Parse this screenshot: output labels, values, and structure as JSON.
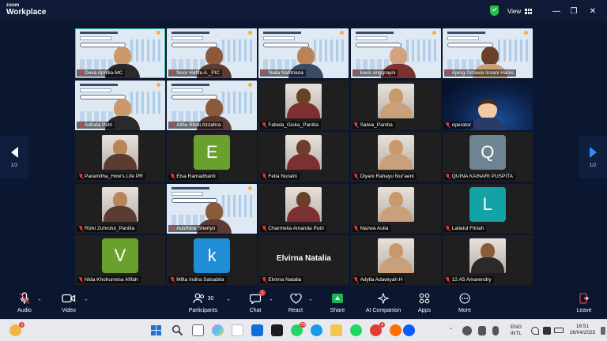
{
  "app": {
    "brand_top": "zoom",
    "brand_bottom": "Workplace",
    "view_label": "View"
  },
  "gallery": {
    "tiles": [
      {
        "name": "Deva Aprillia-MC",
        "kind": "slide",
        "active": true
      },
      {
        "name": "Noor Hafifa A._PIC",
        "kind": "slide"
      },
      {
        "name": "Naila Nafitriana",
        "kind": "slide"
      },
      {
        "name": "luwis anggrayni",
        "kind": "slide"
      },
      {
        "name": "Ajeng Octavia Insani Hanis",
        "kind": "slide"
      },
      {
        "name": "Adinda Putri",
        "kind": "slide"
      },
      {
        "name": "Alifia Rifati Azzahra",
        "kind": "slide"
      },
      {
        "name": "Fabela_Giska_Panitia",
        "kind": "photo"
      },
      {
        "name": "Salwa_Panitia",
        "kind": "photo"
      },
      {
        "name": "operator",
        "kind": "space"
      },
      {
        "name": "Paramitha_How's Life PR",
        "kind": "photo"
      },
      {
        "name": "Elsa Ramadhanti",
        "kind": "avatar",
        "letter": "E",
        "color": "#6aa12e"
      },
      {
        "name": "Felia Nuraini",
        "kind": "photo"
      },
      {
        "name": "Diyani Rahayu Nur'aeni",
        "kind": "photo"
      },
      {
        "name": "QUINA KAINARI PUSPITA",
        "kind": "avatar",
        "letter": "Q",
        "color": "#6c8591"
      },
      {
        "name": "Rizki Zuhrotul_Panitia",
        "kind": "photo"
      },
      {
        "name": "Austhine Sherlyn",
        "kind": "slide"
      },
      {
        "name": "Charmelia Amanda Putri",
        "kind": "photo"
      },
      {
        "name": "Nazwa Aulia",
        "kind": "photo"
      },
      {
        "name": "Lailatul Fitriah",
        "kind": "avatar",
        "letter": "L",
        "color": "#13a2a6"
      },
      {
        "name": "Nida Kholrunnisa Afifah",
        "kind": "avatar",
        "letter": "V",
        "color": "#6aa12e"
      },
      {
        "name": "Mifta Indira Salsabila",
        "kind": "avatar",
        "letter": "k",
        "color": "#1f8ed6"
      },
      {
        "name": "Elvirna Natalia",
        "kind": "text",
        "display": "Elvirna Natalia"
      },
      {
        "name": "Adylla Adawiyah H",
        "kind": "photo"
      },
      {
        "name": "12 A5 Amarendry",
        "kind": "photo"
      }
    ]
  },
  "pager": {
    "left": "1/2",
    "right": "1/2"
  },
  "toolbar": {
    "audio": "Audio",
    "video": "Video",
    "participants": "Participants",
    "participants_count": "30",
    "chat": "Chat",
    "chat_badge": "1",
    "react": "React",
    "share": "Share",
    "ai": "AI Companion",
    "apps": "Apps",
    "more": "More",
    "leave": "Leave"
  },
  "taskbar": {
    "notif_badge": "3",
    "whatsapp_badge": "79",
    "opera_badge": "4",
    "lang_top": "ENG",
    "lang_bottom": "INTL",
    "time": "16:51",
    "date": "26/04/2025"
  },
  "colors": {
    "accent": "#2f8cff",
    "active_border": "#2ed1a8",
    "muted": "#e23b3b"
  }
}
